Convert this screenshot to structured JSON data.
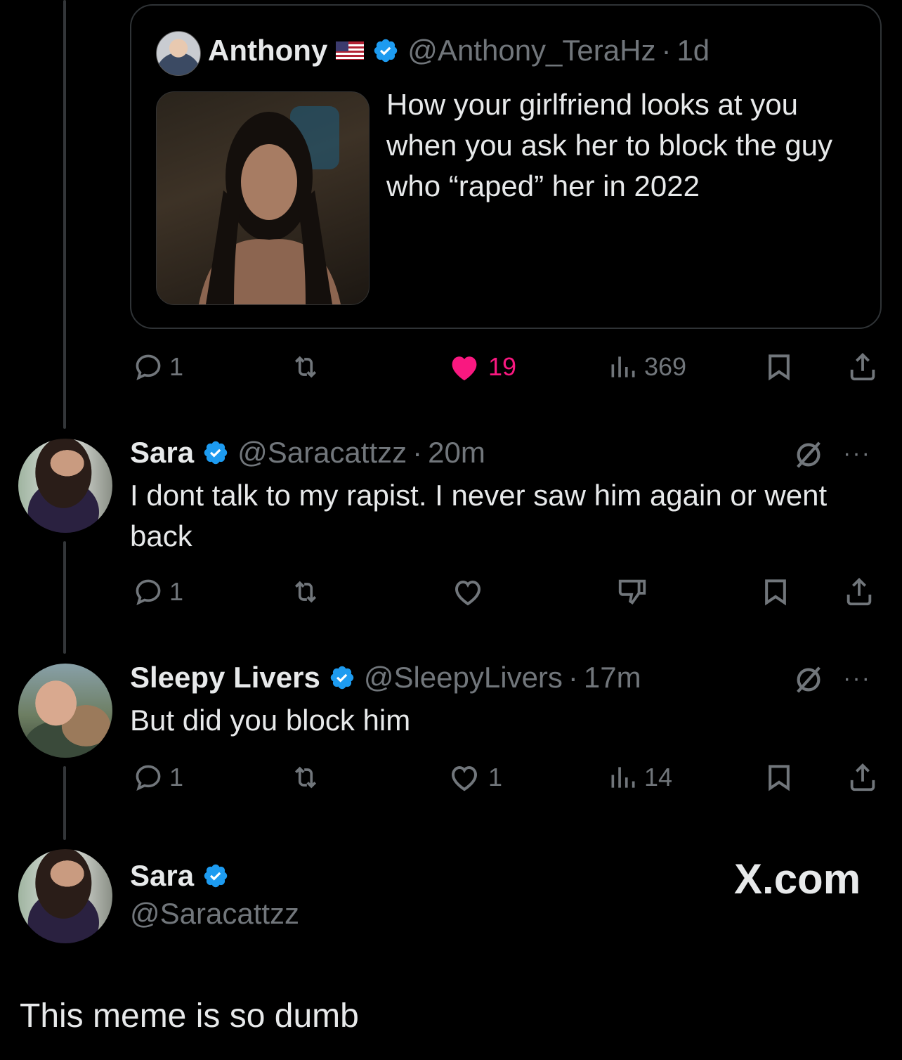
{
  "quoted": {
    "name": "Anthony",
    "handle": "@Anthony_TeraHz",
    "separator": "·",
    "time": "1d",
    "text": "How your girlfriend looks at you when you ask her to block the guy who “raped” her in 2022",
    "flag_icon": "us-flag-icon",
    "actions": {
      "replies": "1",
      "likes": "19",
      "views": "369"
    }
  },
  "tweets": [
    {
      "name": "Sara",
      "handle": "@Saracattzz",
      "separator": "·",
      "time": "20m",
      "text": "I dont talk to my rapist. I never saw him again or went back",
      "more": "···",
      "actions": {
        "replies": "1"
      }
    },
    {
      "name": "Sleepy Livers",
      "handle": "@SleepyLivers",
      "separator": "·",
      "time": "17m",
      "text": "But did you block him",
      "more": "···",
      "actions": {
        "replies": "1",
        "likes": "1",
        "views": "14"
      }
    }
  ],
  "composer": {
    "name": "Sara",
    "handle": "@Saracattzz",
    "site": "X.com"
  },
  "caption": "This meme is so dumb",
  "colors": {
    "background": "#000000",
    "text": "#e7e9ea",
    "muted": "#71767b",
    "verified": "#1d9bf0",
    "like": "#f91880"
  }
}
